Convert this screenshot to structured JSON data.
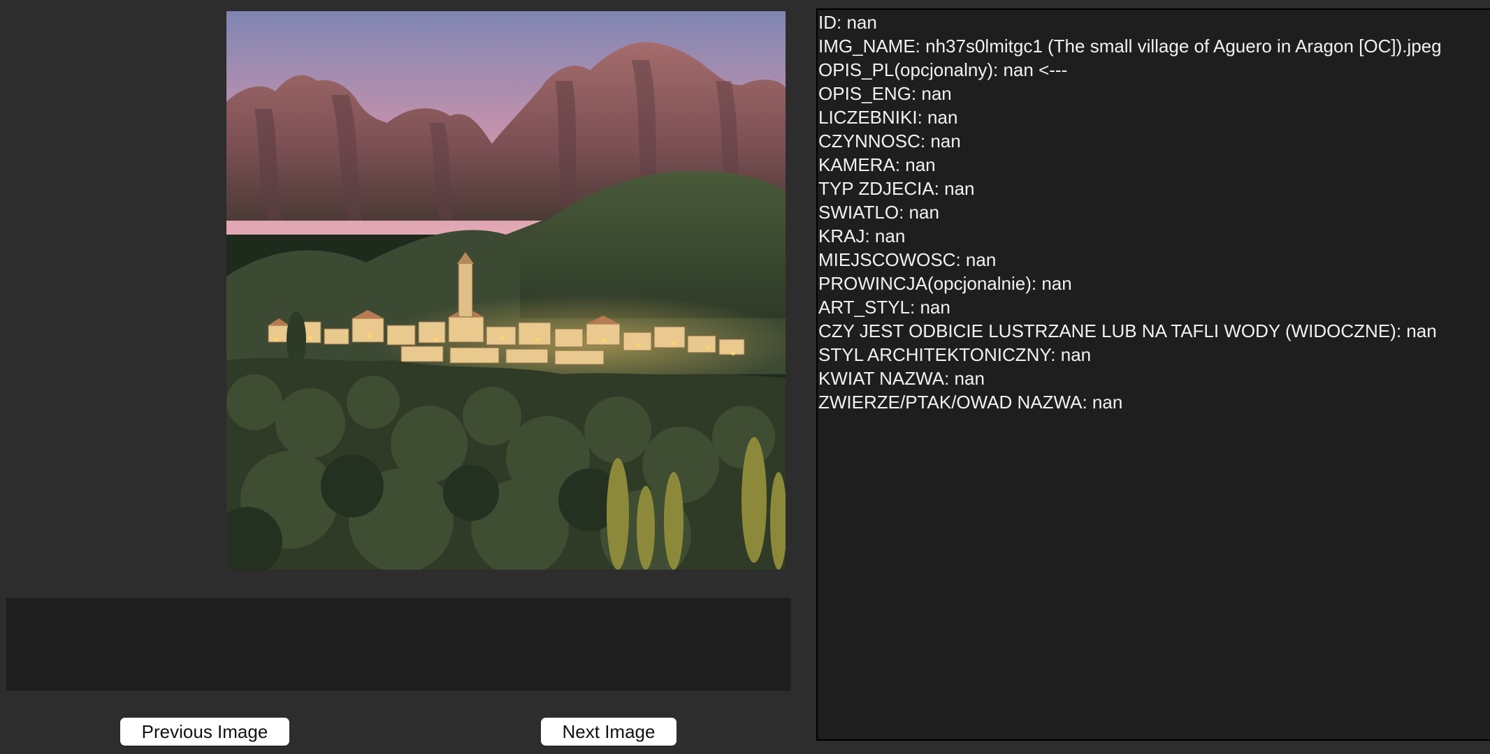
{
  "photo": {
    "alt": "Village beneath red rock cliffs at dusk",
    "colors": {
      "sky_top": "#8d8fb8",
      "sky_bottom": "#d79ab0",
      "rock": "#8a5a5e",
      "rock_shadow": "#5a3b40",
      "forest": "#2f3d2a",
      "village": "#e8c27a",
      "lights": "#ffd36b"
    }
  },
  "buttons": {
    "previous": "Previous Image",
    "next": "Next Image"
  },
  "info": {
    "fields": [
      "ID: nan",
      "IMG_NAME: nh37s0lmitgc1 (The small village of Aguero in Aragon [OC]).jpeg",
      "OPIS_PL(opcjonalny): nan <---",
      "OPIS_ENG: nan",
      "LICZEBNIKI: nan",
      "CZYNNOSC: nan",
      "KAMERA: nan",
      "TYP ZDJECIA: nan",
      "SWIATLO: nan",
      "KRAJ: nan",
      "MIEJSCOWOSC: nan",
      "PROWINCJA(opcjonalnie): nan",
      "ART_STYL: nan",
      "CZY JEST ODBICIE LUSTRZANE LUB NA TAFLI WODY (WIDOCZNE): nan",
      "STYL ARCHITEKTONICZNY: nan",
      "KWIAT NAZWA: nan",
      "ZWIERZE/PTAK/OWAD NAZWA: nan"
    ]
  }
}
